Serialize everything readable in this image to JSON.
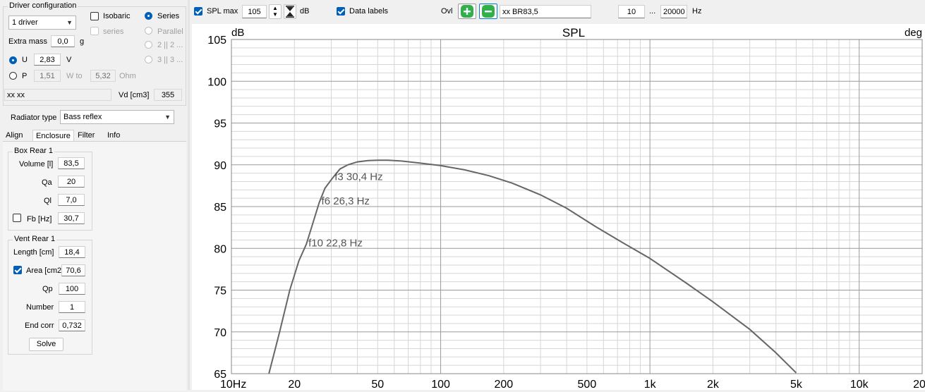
{
  "driver_config": {
    "title": "Driver configuration",
    "driver_count": "1 driver",
    "isobaric_label": "Isobaric",
    "series_checkbox_label": "series",
    "series_radio_label": "Series",
    "parallel_label": "Parallel",
    "opt_2_label": "2 || 2 ...",
    "opt_3_label": "3 || 3 ...",
    "extra_mass_label": "Extra mass",
    "extra_mass_value": "0,0",
    "extra_mass_unit": "g",
    "u_label": "U",
    "u_value": "2,83",
    "u_unit": "V",
    "p_label": "P",
    "p_value": "1,51",
    "w_to_label": "W to",
    "ohm_value": "5,32",
    "ohm_unit": "Ohm",
    "driver_name": "xx xx",
    "vd_label": "Vd [cm3]",
    "vd_value": "355"
  },
  "radiator": {
    "label": "Radiator type",
    "value": "Bass reflex"
  },
  "tabs": [
    "Align",
    "Enclosure",
    "Filter",
    "Info"
  ],
  "box_rear": {
    "title": "Box Rear 1",
    "volume_label": "Volume [l]",
    "volume_value": "83,5",
    "qa_label": "Qa",
    "qa_value": "20",
    "ql_label": "Ql",
    "ql_value": "7,0",
    "fb_label": "Fb [Hz]",
    "fb_value": "30,7"
  },
  "vent_rear": {
    "title": "Vent Rear 1",
    "length_label": "Length [cm]",
    "length_value": "18,4",
    "area_label": "Area [cm2",
    "area_value": "70,6",
    "qp_label": "Qp",
    "qp_value": "100",
    "number_label": "Number",
    "number_value": "1",
    "end_corr_label": "End corr",
    "end_corr_value": "0,732",
    "solve_label": "Solve"
  },
  "toolbar": {
    "spl_max_label": "SPL max",
    "spl_max_value": "105",
    "spl_unit": "dB",
    "data_labels_label": "Data labels",
    "ovl_label": "Ovl",
    "series_name": "xx BR83,5",
    "freq_min": "10",
    "freq_sep": "...",
    "freq_max": "20000",
    "freq_unit": "Hz"
  },
  "colors": {
    "accent": "#005fb8",
    "ovl_button": "#2fb14a",
    "curve": "#666666",
    "grid_major": "#9a9a9a",
    "grid_minor": "#d7d7d7"
  },
  "chart_data": {
    "type": "line",
    "title": "SPL",
    "ylabel": "dB",
    "y2label": "deg",
    "x_scale": "log",
    "xlim": [
      10,
      20000
    ],
    "ylim": [
      65,
      105
    ],
    "yticks": [
      65,
      70,
      75,
      80,
      85,
      90,
      95,
      100,
      105
    ],
    "xticks": [
      {
        "v": 10,
        "label": "10Hz"
      },
      {
        "v": 20,
        "label": "20"
      },
      {
        "v": 50,
        "label": "50"
      },
      {
        "v": 100,
        "label": "100"
      },
      {
        "v": 200,
        "label": "200"
      },
      {
        "v": 500,
        "label": "500"
      },
      {
        "v": 1000,
        "label": "1k"
      },
      {
        "v": 2000,
        "label": "2k"
      },
      {
        "v": 5000,
        "label": "5k"
      },
      {
        "v": 10000,
        "label": "10k"
      },
      {
        "v": 20000,
        "label": "20k"
      }
    ],
    "grid": true,
    "series": [
      {
        "name": "xx BR83,5",
        "x": [
          15.1,
          17,
          19,
          21,
          22.8,
          24,
          26.3,
          28,
          30.4,
          33,
          36,
          40,
          45,
          50,
          56,
          65,
          80,
          100,
          130,
          170,
          220,
          300,
          400,
          550,
          750,
          1000,
          1500,
          2000,
          3000,
          4000,
          5000
        ],
        "y": [
          65,
          70,
          75,
          78.5,
          80.5,
          82.3,
          85.5,
          87.2,
          88.4,
          89.5,
          90.0,
          90.35,
          90.5,
          90.55,
          90.55,
          90.45,
          90.2,
          89.9,
          89.4,
          88.7,
          87.8,
          86.4,
          84.8,
          82.6,
          80.6,
          78.8,
          75.8,
          73.6,
          70.3,
          67.5,
          65.1
        ]
      }
    ],
    "annotations": [
      {
        "x": 30.4,
        "y": 88.4,
        "text": "f3 30,4 Hz"
      },
      {
        "x": 26.3,
        "y": 85.5,
        "text": "f6 26,3 Hz"
      },
      {
        "x": 22.8,
        "y": 80.5,
        "text": "f10 22,8 Hz"
      }
    ]
  }
}
